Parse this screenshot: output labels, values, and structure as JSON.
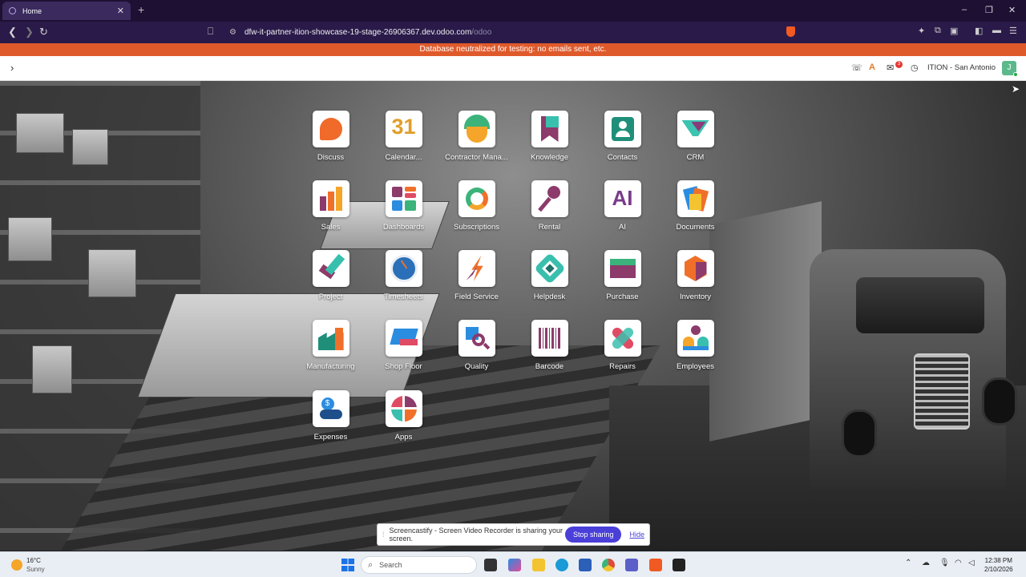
{
  "browser": {
    "tab_title": "Home",
    "new_tab": "+",
    "url_host": "dfw-it-partner-ition-showcase-19-stage-26906367.dev.odoo.com",
    "url_path": "/odoo",
    "window_controls": [
      "–",
      "❐",
      "✕"
    ]
  },
  "banner": {
    "text": "Database neutralized for testing: no emails sent, etc."
  },
  "navbar": {
    "company": "ITION - San Antonio",
    "avatar_letter": "J",
    "chat_count": "3"
  },
  "apps": [
    {
      "label": "Discuss",
      "icon": "discuss-icon"
    },
    {
      "label": "Calendar...",
      "icon": "calendar-icon",
      "glyph": "31"
    },
    {
      "label": "Contractor Mana...",
      "icon": "contractor-icon"
    },
    {
      "label": "Knowledge",
      "icon": "knowledge-icon"
    },
    {
      "label": "Contacts",
      "icon": "contacts-icon"
    },
    {
      "label": "CRM",
      "icon": "crm-icon"
    },
    {
      "label": "Sales",
      "icon": "sales-icon"
    },
    {
      "label": "Dashboards",
      "icon": "dashboards-icon"
    },
    {
      "label": "Subscriptions",
      "icon": "subscriptions-icon"
    },
    {
      "label": "Rental",
      "icon": "rental-icon"
    },
    {
      "label": "AI",
      "icon": "ai-icon",
      "glyph": "AI"
    },
    {
      "label": "Documents",
      "icon": "documents-icon"
    },
    {
      "label": "Project",
      "icon": "project-icon"
    },
    {
      "label": "Timesheets",
      "icon": "timesheets-icon"
    },
    {
      "label": "Field Service",
      "icon": "field-service-icon"
    },
    {
      "label": "Helpdesk",
      "icon": "helpdesk-icon"
    },
    {
      "label": "Purchase",
      "icon": "purchase-icon"
    },
    {
      "label": "Inventory",
      "icon": "inventory-icon"
    },
    {
      "label": "Manufacturing",
      "icon": "manufacturing-icon"
    },
    {
      "label": "Shop Floor",
      "icon": "shop-floor-icon"
    },
    {
      "label": "Quality",
      "icon": "quality-icon"
    },
    {
      "label": "Barcode",
      "icon": "barcode-icon"
    },
    {
      "label": "Repairs",
      "icon": "repairs-icon"
    },
    {
      "label": "Employees",
      "icon": "employees-icon"
    },
    {
      "label": "Expenses",
      "icon": "expenses-icon"
    },
    {
      "label": "Apps",
      "icon": "apps-icon"
    }
  ],
  "screencastify": {
    "message": "Screencastify - Screen Video Recorder is sharing your screen.",
    "stop_label": "Stop sharing",
    "hide_label": "Hide"
  },
  "taskbar": {
    "temperature": "16°C",
    "condition": "Sunny",
    "search_placeholder": "Search",
    "time": "12:38 PM",
    "date": "2/10/2026"
  },
  "colors": {
    "banner": "#df5a2b",
    "browser_chrome": "#2a1a4a",
    "stop_button": "#4a3fd9"
  }
}
